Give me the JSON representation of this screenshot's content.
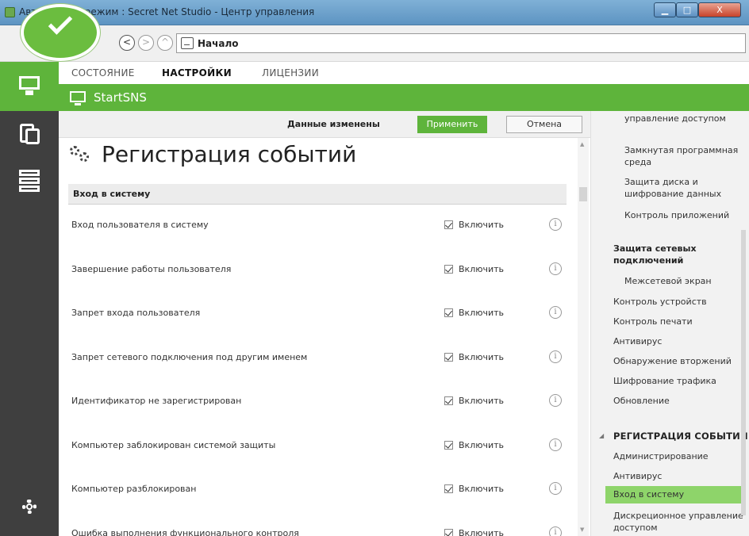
{
  "window": {
    "title": "Автономный режим : Secret Net Studio - Центр управления",
    "min": "▁",
    "max": "□",
    "close": "X"
  },
  "nav": {
    "back": "<",
    "forward": ">",
    "up": "^",
    "address": "Начало"
  },
  "tabs": [
    {
      "label": "СОСТОЯНИЕ"
    },
    {
      "label": "НАСТРОЙКИ"
    },
    {
      "label": "ЛИЦЕНЗИИ"
    }
  ],
  "header": {
    "computer": "StartSNS"
  },
  "actionbar": {
    "status": "Данные изменены",
    "apply": "Применить",
    "cancel": "Отмена"
  },
  "page": {
    "title": "Регистрация событий",
    "section": "Вход в систему"
  },
  "rows": [
    {
      "label": "Вход пользователя в систему",
      "option": "Включить"
    },
    {
      "label": "Завершение работы пользователя",
      "option": "Включить"
    },
    {
      "label": "Запрет входа пользователя",
      "option": "Включить"
    },
    {
      "label": "Запрет сетевого подключения под другим именем",
      "option": "Включить"
    },
    {
      "label": "Идентификатор не зарегистрирован",
      "option": "Включить"
    },
    {
      "label": "Компьютер заблокирован системой защиты",
      "option": "Включить"
    },
    {
      "label": "Компьютер разблокирован",
      "option": "Включить"
    },
    {
      "label": "Ошибка выполнения функционального контроля",
      "option": "Включить"
    }
  ],
  "info_glyph": "i",
  "tree": {
    "items": [
      "управление доступом",
      "Замкнутая программная среда",
      "Защита диска и шифрование данных",
      "Контроль приложений",
      "Защита сетевых подключений",
      "Межсетевой экран",
      "Контроль устройств",
      "Контроль печати",
      "Антивирус",
      "Обнаружение вторжений",
      "Шифрование трафика",
      "Обновление",
      "РЕГИСТРАЦИЯ СОБЫТИЙ",
      "Администрирование",
      "Антивирус",
      "Вход в систему",
      "Дискреционное управление доступом"
    ],
    "selected": "Вход в систему"
  },
  "colors": {
    "accent": "#5eb43b",
    "rail": "#3f3f3f",
    "selected": "#8ed46a"
  },
  "icons": [
    "checkmark-icon",
    "home-icon",
    "monitor-icon",
    "devices-icon",
    "rack-icon",
    "gear-icon",
    "events-icon",
    "info-icon"
  ]
}
